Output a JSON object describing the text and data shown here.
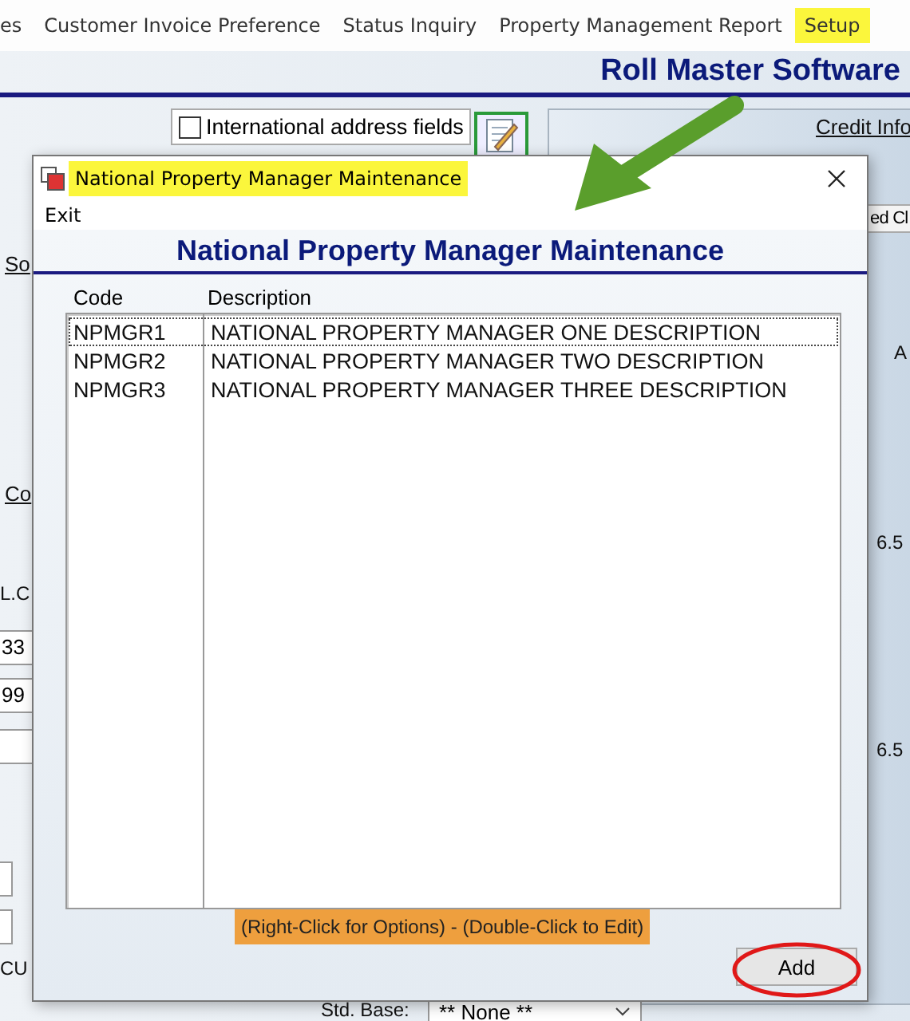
{
  "menu_bar": {
    "items": [
      {
        "label": "es",
        "selected": false
      },
      {
        "label": "Customer Invoice Preference",
        "selected": false
      },
      {
        "label": "Status Inquiry",
        "selected": false
      },
      {
        "label": "Property Management Report",
        "selected": false
      },
      {
        "label": "Setup",
        "selected": true
      }
    ]
  },
  "app_title": "Roll Master Software",
  "background": {
    "international_checkbox": {
      "label": "International address fields",
      "checked": false
    },
    "credit_link": "Credit Info",
    "tab_label": "ed Cl",
    "left_links": [
      "So",
      "Co"
    ],
    "left_texts": [
      "L.C"
    ],
    "left_fields": [
      {
        "value": "33"
      },
      {
        "value": "99"
      }
    ],
    "left_bottom_text": "CU",
    "right_texts": [
      "A",
      "6.5",
      "6.5"
    ],
    "std_base": {
      "label": "Std. Base:",
      "value": "** None **"
    }
  },
  "dialog": {
    "title": "National Property Manager Maintenance",
    "menu": [
      "Exit"
    ],
    "heading": "National Property Manager Maintenance",
    "table": {
      "columns": [
        "Code",
        "Description"
      ],
      "rows": [
        {
          "code": "NPMGR1",
          "description": "NATIONAL PROPERTY MANAGER ONE DESCRIPTION",
          "selected": true
        },
        {
          "code": "NPMGR2",
          "description": "NATIONAL PROPERTY MANAGER TWO DESCRIPTION",
          "selected": false
        },
        {
          "code": "NPMGR3",
          "description": "NATIONAL PROPERTY MANAGER THREE DESCRIPTION",
          "selected": false
        }
      ]
    },
    "hint": "(Right-Click for Options) - (Double-Click to Edit)",
    "buttons": [
      "Add"
    ]
  }
}
